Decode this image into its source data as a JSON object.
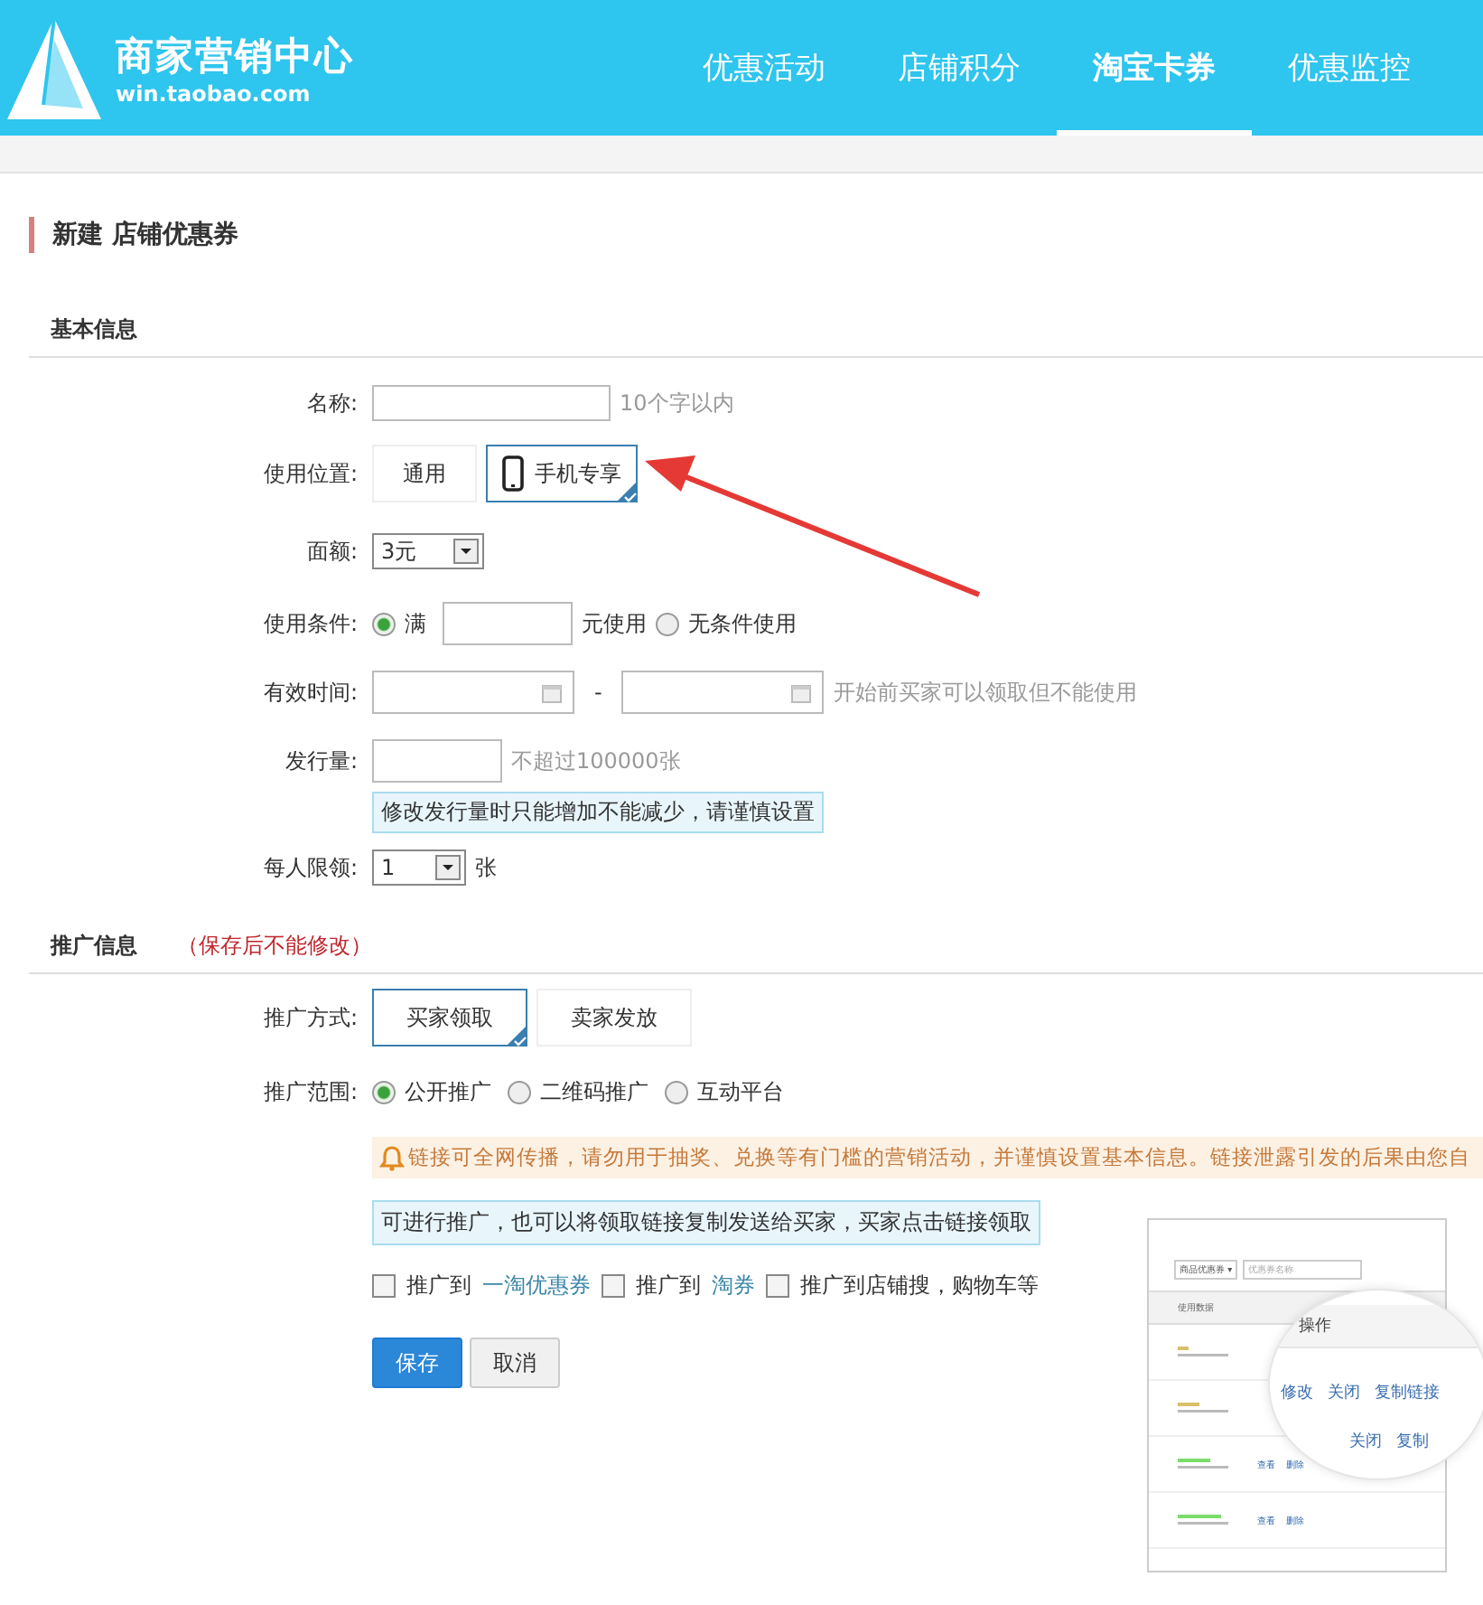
{
  "header": {
    "logo_title": "商家营销中心",
    "logo_url": "win.taobao.com",
    "nav": [
      {
        "label": "优惠活动",
        "selected": false
      },
      {
        "label": "店铺积分",
        "selected": false
      },
      {
        "label": "淘宝卡券",
        "selected": true
      },
      {
        "label": "优惠监控",
        "selected": false
      }
    ]
  },
  "page_title": "新建 店铺优惠券",
  "basic": {
    "title": "基本信息",
    "name": {
      "label": "名称:",
      "hint": "10个字以内"
    },
    "position": {
      "label": "使用位置:",
      "options": [
        {
          "label": "通用",
          "kind": "text",
          "selected": false
        },
        {
          "label": "手机专享",
          "kind": "mobile",
          "selected": true
        }
      ]
    },
    "amount": {
      "label": "面额:",
      "value": "3元"
    },
    "condition": {
      "label": "使用条件:",
      "options": [
        {
          "label": "满",
          "selected": true,
          "unit": "元使用"
        },
        {
          "label": "无条件使用",
          "selected": false
        }
      ]
    },
    "period": {
      "label": "有效时间:",
      "separator": "-",
      "hint": "开始前买家可以领取但不能使用"
    },
    "quantity": {
      "label": "发行量:",
      "hint": "不超过100000张",
      "notice": "修改发行量时只能增加不能减少，请谨慎设置"
    },
    "limit": {
      "label": "每人限领:",
      "value": "1",
      "unit": "张"
    }
  },
  "promo": {
    "title": "推广信息",
    "note": "（保存后不能修改）",
    "method": {
      "label": "推广方式:",
      "options": [
        {
          "label": "买家领取",
          "selected": true
        },
        {
          "label": "卖家发放",
          "selected": false
        }
      ]
    },
    "scope": {
      "label": "推广范围:",
      "options": [
        {
          "label": "公开推广",
          "selected": true
        },
        {
          "label": "二维码推广",
          "selected": false
        },
        {
          "label": "互动平台",
          "selected": false
        }
      ]
    },
    "warning": "链接可全网传播，请勿用于抽奖、兑换等有门槛的营销活动，并谨慎设置基本信息。链接泄露引发的后果由您自",
    "info": "可进行推广，也可以将领取链接复制发送给买家，买家点击链接领取",
    "channels": [
      {
        "prefix": "推广到",
        "link": "一淘优惠券",
        "checked": false
      },
      {
        "prefix": "推广到",
        "link": "淘券",
        "checked": false
      },
      {
        "prefix": "推广到店铺搜，购物车等",
        "checked": false
      }
    ],
    "buttons": [
      {
        "label": "保存",
        "kind": "primary"
      },
      {
        "label": "取消",
        "kind": "secondary"
      }
    ],
    "preview": {
      "filter": "商品优惠券 ▾",
      "search": "优惠券名称",
      "column": "使用数据",
      "rows": [
        {
          "links": []
        },
        {
          "links": []
        },
        {
          "links": [
            "查看",
            "删除"
          ]
        },
        {
          "links": [
            "查看",
            "删除"
          ]
        }
      ],
      "zoom_header": "操作",
      "zoom_rows": [
        [
          "修改",
          "关闭",
          "复制链接"
        ],
        [
          "关闭",
          "复制"
        ]
      ]
    }
  }
}
